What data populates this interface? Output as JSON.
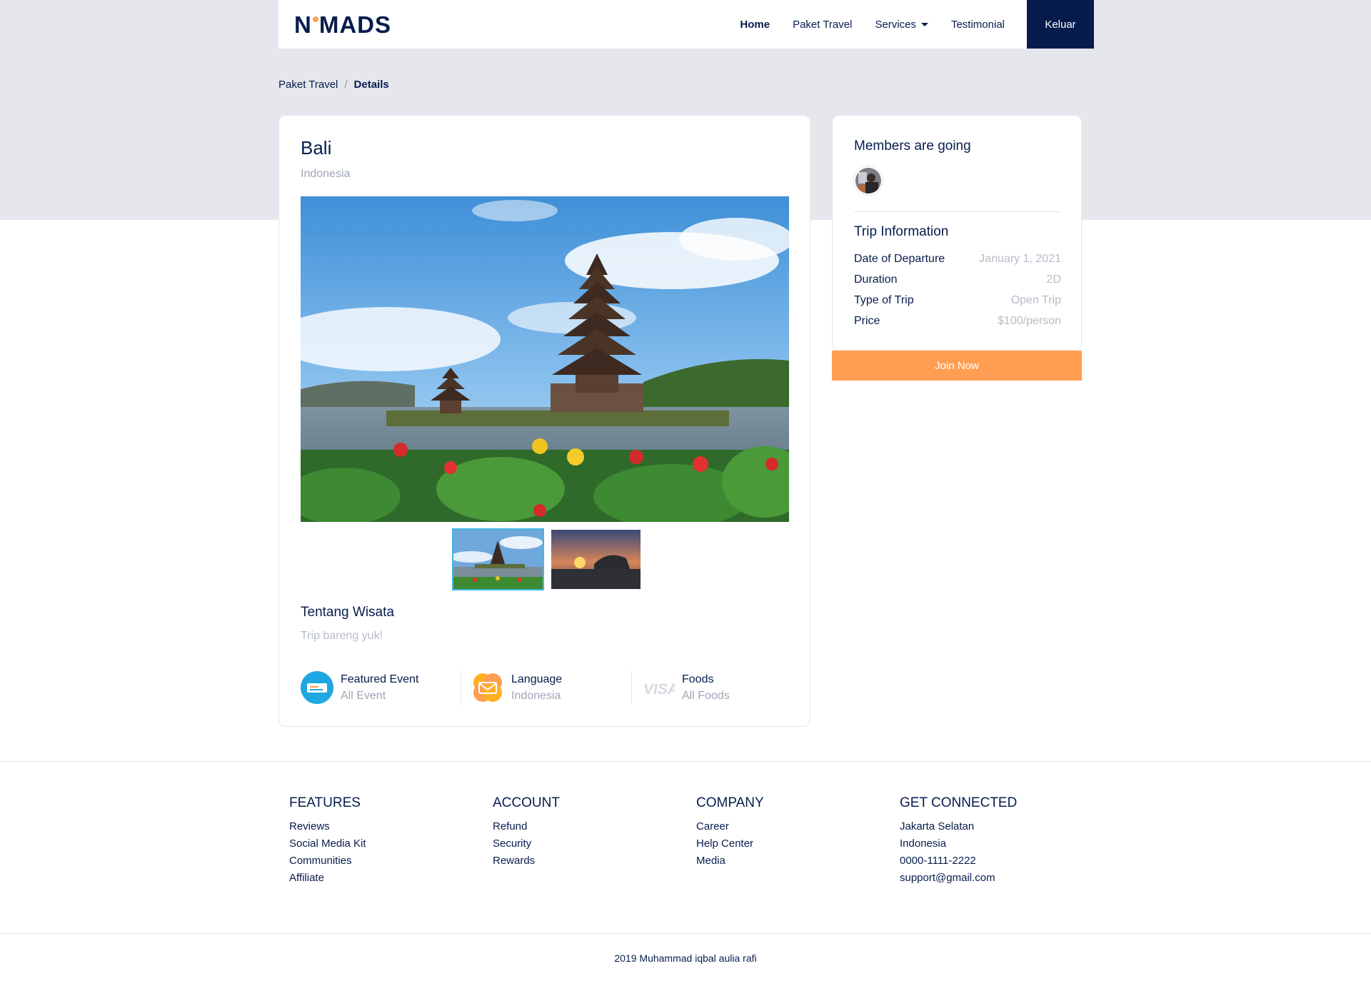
{
  "brand": {
    "logo_text_left": "N",
    "logo_text_right": "MADS"
  },
  "nav": {
    "items": [
      {
        "label": "Home"
      },
      {
        "label": "Paket Travel"
      },
      {
        "label": "Services"
      },
      {
        "label": "Testimonial"
      }
    ],
    "logout_label": "Keluar"
  },
  "breadcrumb": {
    "parent": "Paket Travel",
    "separator": "/",
    "current": "Details"
  },
  "details": {
    "title": "Bali",
    "country": "Indonesia",
    "about_title": "Tentang Wisata",
    "about_text": "Trip bareng yuk!",
    "features": [
      {
        "name": "Featured Event",
        "value": "All Event",
        "icon": "ticket-icon"
      },
      {
        "name": "Language",
        "value": "Indonesia",
        "icon": "language-icon"
      },
      {
        "name": "Foods",
        "value": "All Foods",
        "icon": "visa-icon"
      }
    ]
  },
  "sidebar": {
    "members_title": "Members are going",
    "trip_title": "Trip Information",
    "trip_info": [
      {
        "key": "Date of Departure",
        "value": "January 1, 2021"
      },
      {
        "key": "Duration",
        "value": "2D"
      },
      {
        "key": "Type of Trip",
        "value": "Open Trip"
      },
      {
        "key": "Price",
        "value": "$100/person"
      }
    ],
    "join_label": "Join Now"
  },
  "footer": {
    "columns": [
      {
        "title": "FEATURES",
        "links": [
          "Reviews",
          "Social Media Kit",
          "Communities",
          "Affiliate"
        ]
      },
      {
        "title": "ACCOUNT",
        "links": [
          "Refund",
          "Security",
          "Rewards"
        ]
      },
      {
        "title": "COMPANY",
        "links": [
          "Career",
          "Help Center",
          "Media"
        ]
      },
      {
        "title": "GET CONNECTED",
        "links": [
          "Jakarta Selatan",
          "Indonesia",
          "0000-1111-2222",
          "support@gmail.com"
        ]
      }
    ],
    "copyright": "2019 Muhammad iqbal aulia rafi"
  },
  "colors": {
    "primary": "#071c4d",
    "accent": "#ff9e53",
    "muted": "#9ea5b5",
    "hero_bg": "#e5e7ec"
  }
}
